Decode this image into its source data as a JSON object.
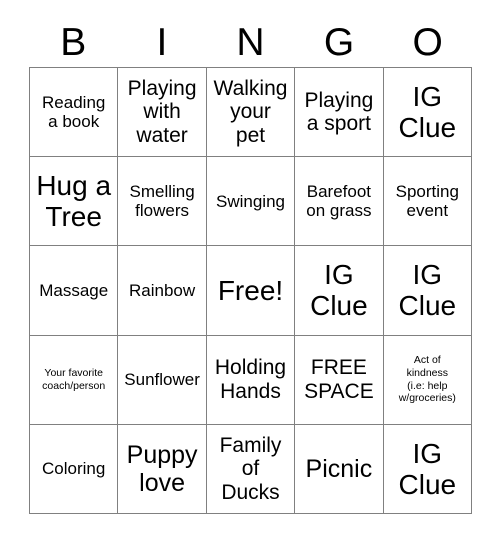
{
  "card": {
    "title_letters": [
      "B",
      "I",
      "N",
      "G",
      "O"
    ],
    "columns": 5,
    "rows": 5,
    "grid_color": "#808080",
    "background_color": "#ffffff",
    "text_color": "#000000",
    "cells": [
      {
        "text": "Reading\na book",
        "size": "md"
      },
      {
        "text": "Playing\nwith\nwater",
        "size": "lg"
      },
      {
        "text": "Walking\nyour\npet",
        "size": "lg"
      },
      {
        "text": "Playing\na sport",
        "size": "lg"
      },
      {
        "text": "IG\nClue",
        "size": "xxl"
      },
      {
        "text": "Hug a\nTree",
        "size": "xxl"
      },
      {
        "text": "Smelling\nflowers",
        "size": "md"
      },
      {
        "text": "Swinging",
        "size": "md"
      },
      {
        "text": "Barefoot\non grass",
        "size": "md"
      },
      {
        "text": "Sporting\nevent",
        "size": "md"
      },
      {
        "text": "Massage",
        "size": "md"
      },
      {
        "text": "Rainbow",
        "size": "md"
      },
      {
        "text": "Free!",
        "size": "xxl"
      },
      {
        "text": "IG\nClue",
        "size": "xxl"
      },
      {
        "text": "IG\nClue",
        "size": "xxl"
      },
      {
        "text": "Your favorite\ncoach/person",
        "size": "xs"
      },
      {
        "text": "Sunflower",
        "size": "md"
      },
      {
        "text": "Holding\nHands",
        "size": "lg"
      },
      {
        "text": "FREE\nSPACE",
        "size": "lg"
      },
      {
        "text": "Act of\nkindness\n(i.e: help\nw/groceries)",
        "size": "xs"
      },
      {
        "text": "Coloring",
        "size": "md"
      },
      {
        "text": "Puppy\nlove",
        "size": "xl"
      },
      {
        "text": "Family\nof\nDucks",
        "size": "lg"
      },
      {
        "text": "Picnic",
        "size": "xl"
      },
      {
        "text": "IG\nClue",
        "size": "xxl"
      }
    ]
  }
}
